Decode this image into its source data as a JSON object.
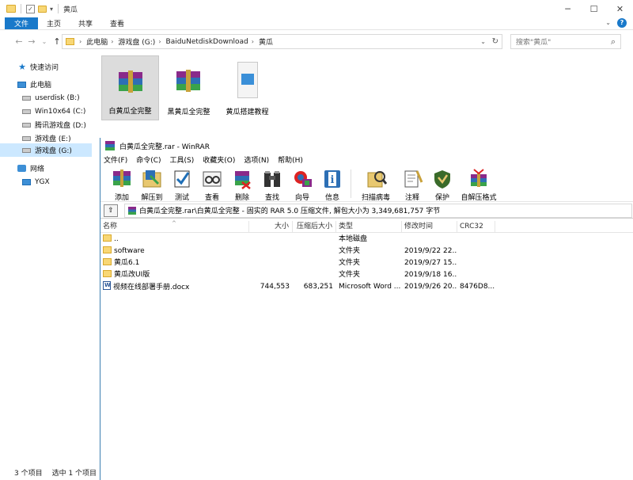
{
  "explorer": {
    "title": "黄瓜",
    "window_controls": {
      "minimize": "─",
      "maximize": "☐",
      "close": "✕"
    },
    "ribbon_tabs": [
      "文件",
      "主页",
      "共享",
      "查看"
    ],
    "help": "?",
    "nav_buttons": {
      "back": "←",
      "forward": "→",
      "recent": "⌄",
      "up": "↑"
    },
    "breadcrumb": [
      "此电脑",
      "游戏盘 (G:)",
      "BaiduNetdiskDownload",
      "黄瓜"
    ],
    "search_placeholder": "搜索\"黄瓜\"",
    "nav_pane": [
      {
        "label": "快速访问",
        "icon": "star-icon"
      },
      {
        "label": "此电脑",
        "icon": "computer-icon"
      },
      {
        "label": "userdisk (B:)",
        "icon": "drive-icon"
      },
      {
        "label": "Win10x64 (C:)",
        "icon": "drive-icon"
      },
      {
        "label": "腾讯游戏盘 (D:)",
        "icon": "drive-icon"
      },
      {
        "label": "游戏盘 (E:)",
        "icon": "drive-icon"
      },
      {
        "label": "游戏盘 (G:)",
        "icon": "drive-icon",
        "selected": true
      },
      {
        "label": "网络",
        "icon": "network-icon"
      },
      {
        "label": "YGX",
        "icon": "computer-icon"
      }
    ],
    "files": [
      {
        "label": "白黄瓜全完整",
        "type": "rar",
        "selected": true
      },
      {
        "label": "黑黄瓜全完整",
        "type": "rar"
      },
      {
        "label": "黄瓜搭建教程",
        "type": "video"
      }
    ],
    "status": {
      "count": "3 个项目",
      "selected": "选中 1 个项目"
    }
  },
  "winrar": {
    "title": "白黄瓜全完整.rar - WinRAR",
    "menu": [
      "文件(F)",
      "命令(C)",
      "工具(S)",
      "收藏夹(O)",
      "选项(N)",
      "帮助(H)"
    ],
    "toolbar": [
      {
        "label": "添加",
        "icon": "add-icon"
      },
      {
        "label": "解压到",
        "icon": "extract-icon"
      },
      {
        "label": "测试",
        "icon": "test-icon"
      },
      {
        "label": "查看",
        "icon": "view-icon"
      },
      {
        "label": "删除",
        "icon": "delete-icon"
      },
      {
        "label": "查找",
        "icon": "find-icon"
      },
      {
        "label": "向导",
        "icon": "wizard-icon"
      },
      {
        "label": "信息",
        "icon": "info-icon"
      },
      {
        "label": "扫描病毒",
        "icon": "virus-scan-icon"
      },
      {
        "label": "注释",
        "icon": "comment-icon"
      },
      {
        "label": "保护",
        "icon": "protect-icon"
      },
      {
        "label": "自解压格式",
        "icon": "sfx-icon"
      }
    ],
    "path": "白黄瓜全完整.rar\\白黄瓜全完整 - 固实的 RAR 5.0 压缩文件, 解包大小为 3,349,681,757 字节",
    "columns": [
      "名称",
      "大小",
      "压缩后大小",
      "类型",
      "修改时间",
      "CRC32"
    ],
    "rows": [
      {
        "name": "..",
        "size": "",
        "packed": "",
        "type": "本地磁盘",
        "modified": "",
        "crc": "",
        "kind": "folder"
      },
      {
        "name": "software",
        "size": "",
        "packed": "",
        "type": "文件夹",
        "modified": "2019/9/22 22...",
        "crc": "",
        "kind": "folder"
      },
      {
        "name": "黄瓜6.1",
        "size": "",
        "packed": "",
        "type": "文件夹",
        "modified": "2019/9/27 15...",
        "crc": "",
        "kind": "folder"
      },
      {
        "name": "黄瓜改UI版",
        "size": "",
        "packed": "",
        "type": "文件夹",
        "modified": "2019/9/18 16...",
        "crc": "",
        "kind": "folder"
      },
      {
        "name": "视频在线部署手册.docx",
        "size": "744,553",
        "packed": "683,251",
        "type": "Microsoft Word ...",
        "modified": "2019/9/26 20...",
        "crc": "8476D8...",
        "kind": "doc"
      }
    ]
  }
}
